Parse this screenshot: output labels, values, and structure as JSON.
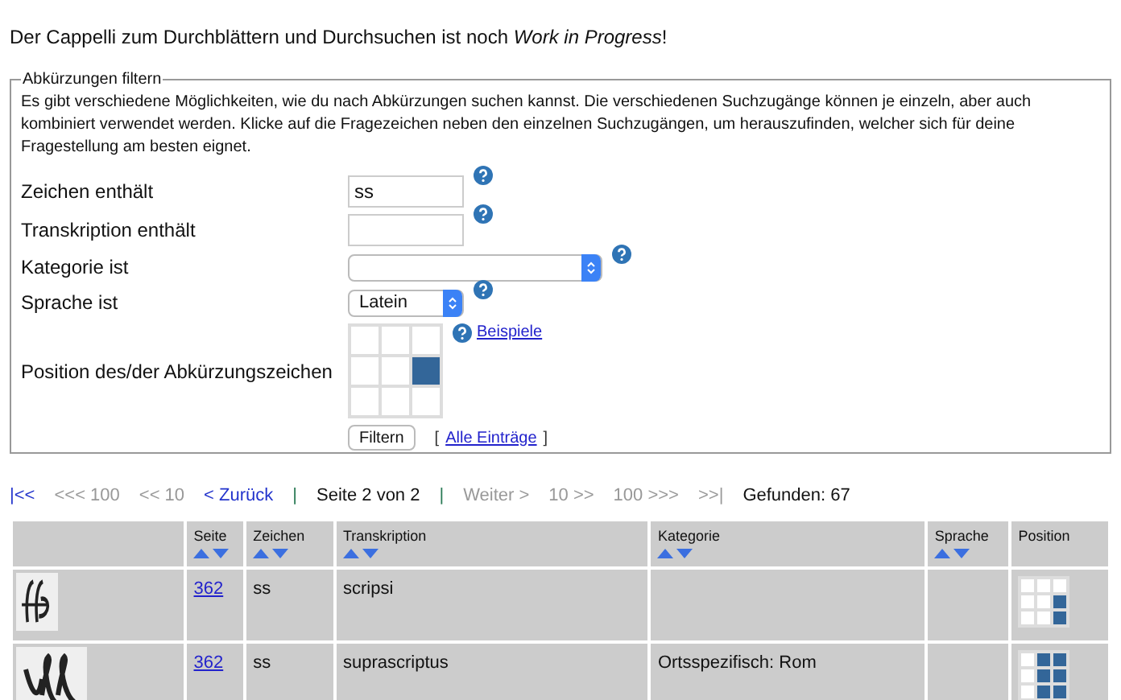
{
  "intro": "Der Cappelli zum Durchblättern und Durchsuchen ist noch *Work in Progress*!",
  "filter": {
    "legend": "Abkürzungen filtern",
    "description": "Es gibt verschiedene Möglichkeiten, wie du nach Abkürzungen suchen kannst. Die verschiedenen Suchzugänge können je einzeln, aber auch kombiniert verwendet werden. Klicke auf die Fragezeichen neben den einzelnen Suchzugängen, um herauszufinden, welcher sich für deine Fragestellung am besten eignet.",
    "fields": [
      {
        "kind": "text",
        "label": "Zeichen enthält",
        "value": "ss"
      },
      {
        "kind": "text",
        "label": "Transkription enthält"
      },
      {
        "kind": "select",
        "label": "Kategorie ist",
        "wide": true
      },
      {
        "kind": "select",
        "label": "Sprache ist",
        "value": "Latein",
        "wide": false
      },
      {
        "kind": "position",
        "label": "Position des/der Abkürzungszeichen",
        "link": "Beispiele",
        "cells": [
          {
            "selected": false
          },
          {
            "selected": false
          },
          {
            "selected": false
          },
          {
            "selected": false
          },
          {
            "selected": false
          },
          {
            "selected": true
          },
          {
            "selected": false
          },
          {
            "selected": false
          },
          {
            "selected": false
          }
        ]
      }
    ],
    "submit": "Filtern",
    "all_open": "[",
    "all_link": "Alle Einträge",
    "all_close": "]"
  },
  "pager": [
    {
      "kind": "link",
      "label": "|<<",
      "disabled": false
    },
    {
      "kind": "link",
      "label": "<<< 100",
      "disabled": true
    },
    {
      "kind": "link",
      "label": "<< 10",
      "disabled": true
    },
    {
      "kind": "link",
      "label": "< Zurück",
      "disabled": false
    },
    {
      "kind": "sep",
      "label": "|"
    },
    {
      "kind": "text",
      "label": "Seite 2 von 2"
    },
    {
      "kind": "sep",
      "label": "|"
    },
    {
      "kind": "link",
      "label": "Weiter >",
      "disabled": true
    },
    {
      "kind": "link",
      "label": "10 >>",
      "disabled": true
    },
    {
      "kind": "link",
      "label": "100 >>>",
      "disabled": true
    },
    {
      "kind": "link",
      "label": ">>|",
      "disabled": true
    },
    {
      "kind": "text",
      "label": "Gefunden: 67"
    }
  ],
  "table": {
    "columns": [
      {
        "sortable": false
      },
      {
        "label": "Seite",
        "sortable": true
      },
      {
        "label": "Zeichen",
        "sortable": true
      },
      {
        "label": "Transkription",
        "sortable": true
      },
      {
        "label": "Kategorie",
        "sortable": true
      },
      {
        "label": "Sprache",
        "sortable": true
      },
      {
        "label": "Position",
        "sortable": false
      }
    ],
    "rows": [
      {
        "page": "362",
        "sign": "ss",
        "transcription": "scripsi",
        "position": [
          false,
          false,
          false,
          false,
          false,
          true,
          false,
          false,
          true
        ]
      },
      {
        "page": "362",
        "sign": "ss",
        "transcription": "suprascriptus",
        "category": "Ortsspezifisch: Rom",
        "position": [
          false,
          true,
          true,
          false,
          true,
          true,
          false,
          true,
          true
        ]
      }
    ]
  }
}
